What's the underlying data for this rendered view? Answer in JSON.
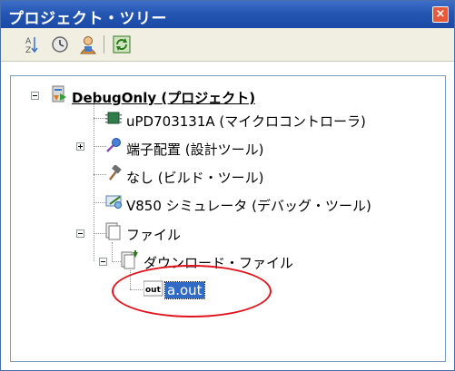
{
  "window": {
    "title": "プロジェクト・ツリー",
    "close_label": "×"
  },
  "toolbar": {
    "buttons": [
      {
        "icon": "sort-az-icon"
      },
      {
        "icon": "clock-icon"
      },
      {
        "icon": "person-icon"
      },
      {
        "icon": "refresh-icon"
      }
    ]
  },
  "tree": {
    "root": {
      "label": "DebugOnly (プロジェクト)",
      "expanded": true
    },
    "items": [
      {
        "label": "uPD703131A (マイクロコントローラ)",
        "icon": "microcontroller-icon"
      },
      {
        "label": "端子配置 (設計ツール)",
        "icon": "pin-config-icon",
        "expandable": true
      },
      {
        "label": "なし (ビルド・ツール)",
        "icon": "hammer-icon"
      },
      {
        "label": "V850 シミュレータ (デバッグ・ツール)",
        "icon": "simulator-icon"
      },
      {
        "label": "ファイル",
        "icon": "folder-icon",
        "expanded": true
      }
    ],
    "sub_folder": {
      "label": "ダウンロード・ファイル",
      "icon": "download-folder-icon",
      "expanded": true
    },
    "file": {
      "label": "a.out",
      "icon_text": "out",
      "selected": true
    }
  },
  "colors": {
    "titlebar": "#2456b3",
    "selection": "#316ac5",
    "annotation": "#e0141d"
  }
}
